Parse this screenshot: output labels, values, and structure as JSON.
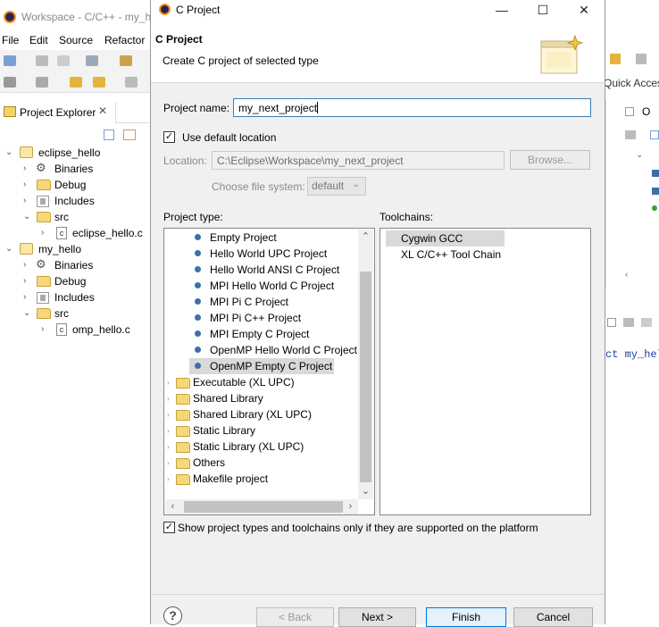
{
  "background": {
    "window_title": "Workspace - C/C++ - my_h",
    "menu": [
      "File",
      "Edit",
      "Source",
      "Refactor"
    ],
    "project_explorer": {
      "tab_label": "Project Explorer",
      "tab_close": "✕",
      "tree": [
        {
          "label": "eclipse_hello",
          "kind": "project",
          "expanded": true
        },
        {
          "label": "Binaries",
          "kind": "binaries"
        },
        {
          "label": "Debug",
          "kind": "folder"
        },
        {
          "label": "Includes",
          "kind": "includes"
        },
        {
          "label": "src",
          "kind": "folder",
          "expanded": true
        },
        {
          "label": "eclipse_hello.c",
          "kind": "cfile"
        },
        {
          "label": "my_hello",
          "kind": "project",
          "expanded": true
        },
        {
          "label": "Binaries",
          "kind": "binaries"
        },
        {
          "label": "Debug",
          "kind": "folder"
        },
        {
          "label": "Includes",
          "kind": "includes"
        },
        {
          "label": "src",
          "kind": "folder",
          "expanded": true
        },
        {
          "label": "omp_hello.c",
          "kind": "cfile"
        }
      ]
    },
    "quick_access_label": "Quick Acces",
    "right_panel_letter": "O",
    "code_snippet": "ct my_hel"
  },
  "dialog": {
    "title": "C Project",
    "window_controls": {
      "minimize": "—",
      "maximize": "☐",
      "close": "✕"
    },
    "banner": {
      "title": "C Project",
      "description": "Create C project of selected type"
    },
    "project_name": {
      "label": "Project name:",
      "value": "my_next_project"
    },
    "use_default_location": {
      "label": "Use default location",
      "checked": true
    },
    "location": {
      "label": "Location:",
      "value": "C:\\Eclipse\\Workspace\\my_next_project",
      "browse_label": "Browse..."
    },
    "file_system": {
      "label": "Choose file system:",
      "value": "default"
    },
    "project_type": {
      "label": "Project type:",
      "items": [
        {
          "label": "Empty Project",
          "kind": "leaf"
        },
        {
          "label": "Hello World UPC Project",
          "kind": "leaf"
        },
        {
          "label": "Hello World ANSI C Project",
          "kind": "leaf"
        },
        {
          "label": "MPI Hello World C Project",
          "kind": "leaf"
        },
        {
          "label": "MPI Pi C Project",
          "kind": "leaf"
        },
        {
          "label": "MPI Pi C++ Project",
          "kind": "leaf"
        },
        {
          "label": "MPI Empty C Project",
          "kind": "leaf"
        },
        {
          "label": "OpenMP Hello World C Project",
          "kind": "leaf"
        },
        {
          "label": "OpenMP Empty C Project",
          "kind": "leaf",
          "selected": true
        },
        {
          "label": "Executable (XL UPC)",
          "kind": "folder"
        },
        {
          "label": "Shared Library",
          "kind": "folder"
        },
        {
          "label": "Shared Library (XL UPC)",
          "kind": "folder"
        },
        {
          "label": "Static Library",
          "kind": "folder"
        },
        {
          "label": "Static Library (XL UPC)",
          "kind": "folder"
        },
        {
          "label": "Others",
          "kind": "folder"
        },
        {
          "label": "Makefile project",
          "kind": "folder"
        }
      ]
    },
    "toolchains": {
      "label": "Toolchains:",
      "items": [
        {
          "label": "Cygwin GCC",
          "selected": true
        },
        {
          "label": "XL C/C++ Tool Chain",
          "selected": false
        }
      ]
    },
    "show_supported": {
      "label": "Show project types and toolchains only if they are supported on the platform",
      "checked": true
    },
    "buttons": {
      "back": "< Back",
      "next": "Next >",
      "finish": "Finish",
      "cancel": "Cancel",
      "help": "?"
    },
    "colors": {
      "accent": "#0078d7",
      "selection": "#d9d9d9",
      "bullet": "#3e6fa8"
    }
  }
}
